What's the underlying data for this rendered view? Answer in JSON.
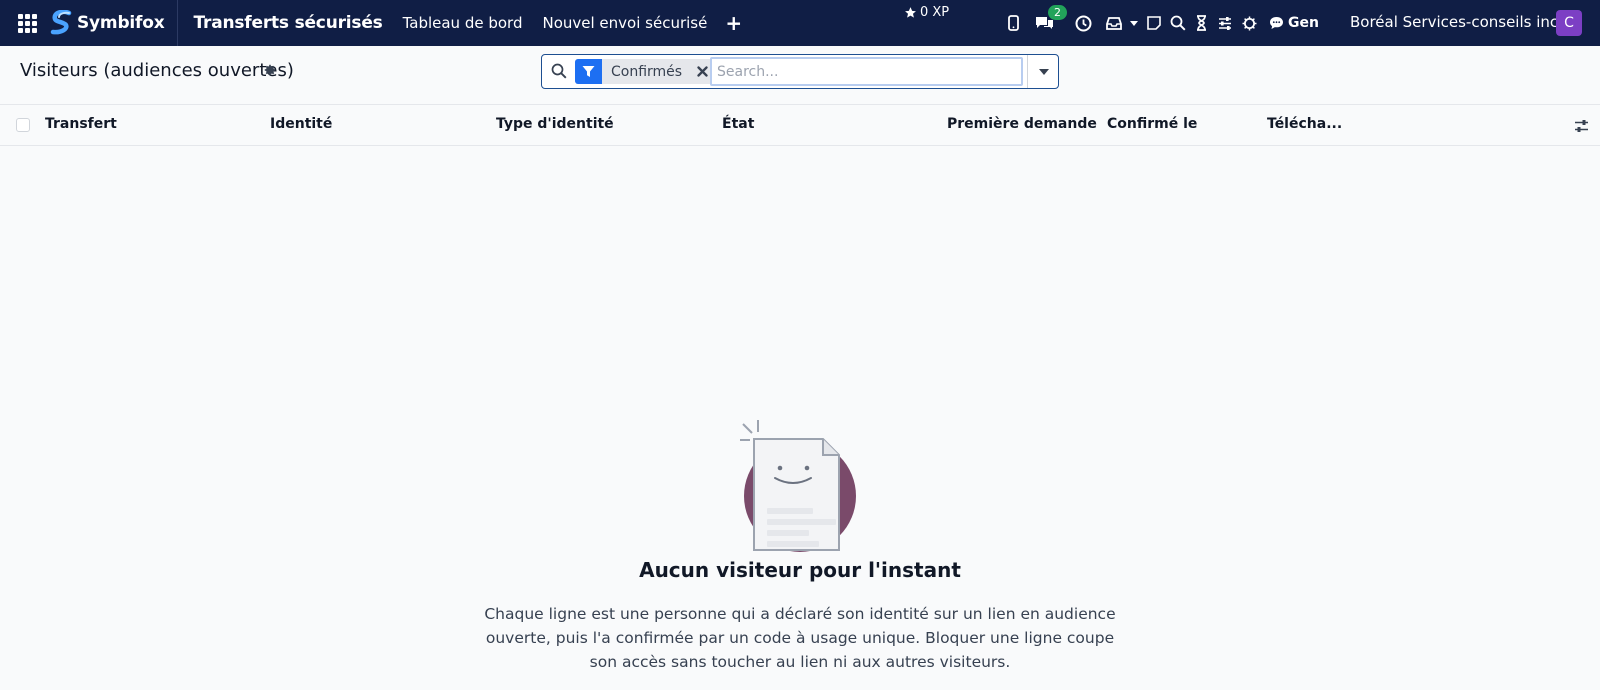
{
  "navbar": {
    "brand": "Symbifox",
    "app_title": "Transferts sécurisés",
    "menu": [
      "Tableau de bord",
      "Nouvel envoi sécurisé"
    ],
    "xp": "0 XP",
    "chat_badge": "2",
    "gen_label": "Gen",
    "company": "Boréal Services-conseils inc.",
    "avatar_initial": "C"
  },
  "control": {
    "title": "Visiteurs (audiences ouvertes)",
    "facet_label": "Confirmés",
    "search_placeholder": "Search..."
  },
  "table": {
    "columns": [
      "Transfert",
      "Identité",
      "Type d'identité",
      "État",
      "Première demande",
      "Confirmé le",
      "Télécha..."
    ]
  },
  "empty_state": {
    "title": "Aucun visiteur pour l'instant",
    "text": "Chaque ligne est une personne qui a déclaré son identité sur un lien en audience ouverte, puis l'a confirmée par un code à usage unique. Bloquer une ligne coupe son accès sans toucher au lien ni aux autres visiteurs."
  },
  "colors": {
    "navbar_bg": "#101e45",
    "accent": "#1d6ff2",
    "badge": "#22a35a",
    "avatar": "#7c3fc4",
    "illustration_circle": "#7a4a6a"
  }
}
